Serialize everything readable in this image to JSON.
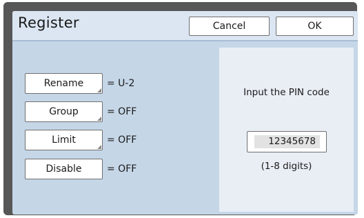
{
  "dialog": {
    "title": "Register",
    "cancel_label": "Cancel",
    "ok_label": "OK"
  },
  "settings": [
    {
      "label": "Rename",
      "value": "= U-2"
    },
    {
      "label": "Group",
      "value": "= OFF"
    },
    {
      "label": "Limit",
      "value": "= OFF"
    },
    {
      "label": "Disable",
      "value": "= OFF"
    }
  ],
  "pin": {
    "prompt": "Input the PIN code",
    "value": "12345678",
    "hint": "(1-8 digits)"
  },
  "colors": {
    "screen_background": "#c5d6e7",
    "titlebar_background": "#dbe6f2",
    "panel_background": "#e9eef5",
    "bezel": "#575757"
  }
}
